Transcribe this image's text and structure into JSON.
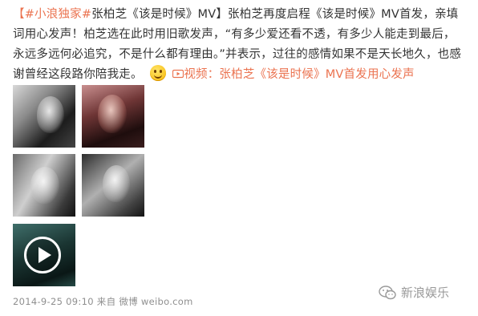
{
  "post": {
    "tag": "【#小浪独家#",
    "title_rest": "张柏芝《该是时候》MV】",
    "body": "张柏芝再度启程《该是时候》MV首发，亲填词用心发声！柏芝选在此时用旧歌发声，“有多少爱还看不透，有多少人能走到最后，永远多远何必追究，不是什么都有理由。”并表示，过往的感情如果不是天长地久，也感谢曾经这段路你陪我走。",
    "video_link": "视频：张柏芝《该是时候》MV首发用心发声"
  },
  "meta": {
    "timestamp": "2014-9-25 09:10",
    "source_prefix": "来自",
    "source": "微博 weibo.com"
  },
  "watermark": {
    "text": "新浪娱乐"
  },
  "icons": {
    "emoji": "smile-emoji-icon",
    "video": "video-link-icon",
    "play": "play-icon",
    "watermark": "wechat-icon"
  },
  "colors": {
    "link": "#eb7350",
    "text": "#333333",
    "meta": "#8f8f8f"
  }
}
